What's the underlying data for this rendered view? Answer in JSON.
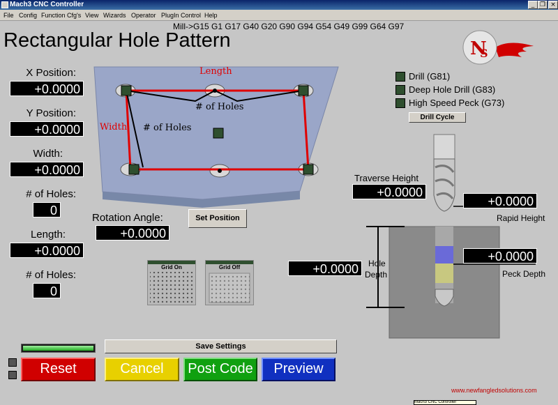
{
  "window": {
    "title": "Mach3 CNC Controller"
  },
  "menu": [
    "File",
    "Config",
    "Function Cfg's",
    "View",
    "Wizards",
    "Operator",
    "PlugIn Control",
    "Help"
  ],
  "gcode_line": "Mill->G15  G1 G17 G40 G20 G90 G94 G54 G49 G99 G64 G97",
  "page_title": "Rectangular Hole Pattern",
  "fields": {
    "x_position": {
      "label": "X Position:",
      "value": "+0.0000"
    },
    "y_position": {
      "label": "Y Position:",
      "value": "+0.0000"
    },
    "width": {
      "label": "Width:",
      "value": "+0.0000"
    },
    "holes_width": {
      "label": "# of Holes:",
      "value": "0"
    },
    "length": {
      "label": "Length:",
      "value": "+0.0000"
    },
    "holes_length": {
      "label": "# of Holes:",
      "value": "0"
    },
    "rotation": {
      "label": "Rotation Angle:",
      "value": "+0.0000"
    }
  },
  "diagram": {
    "length": "Length",
    "width": "Width",
    "holes_top": "# of Holes",
    "holes_side": "# of Holes"
  },
  "buttons": {
    "set_position": "Set Position",
    "drill_cycle": "Drill Cycle",
    "save_settings": "Save Settings",
    "reset": "Reset",
    "cancel": "Cancel",
    "post_code": "Post Code",
    "preview": "Preview",
    "grid_on": "Grid On",
    "grid_off": "Grid Off"
  },
  "drill_options": [
    "Drill (G81)",
    "Deep Hole Drill (G83)",
    "High Speed Peck (G73)"
  ],
  "depths": {
    "traverse_label": "Traverse Height",
    "traverse_value": "+0.0000",
    "rapid_label": "Rapid Height",
    "rapid_value": "+0.0000",
    "peck_label": "Peck Depth",
    "peck_value": "+0.0000",
    "hole_label_1": "Hole",
    "hole_label_2": "Depth",
    "hole_value": "+0.0000"
  },
  "footer_url": "www.newfangledsolutions.com",
  "taskbar_tooltip": "Mach3 CNC Controller",
  "colors": {
    "reset": "#d00000",
    "cancel": "#e8d000",
    "post": "#10a010",
    "preview": "#1030c0",
    "pattern_line": "#e00000"
  }
}
